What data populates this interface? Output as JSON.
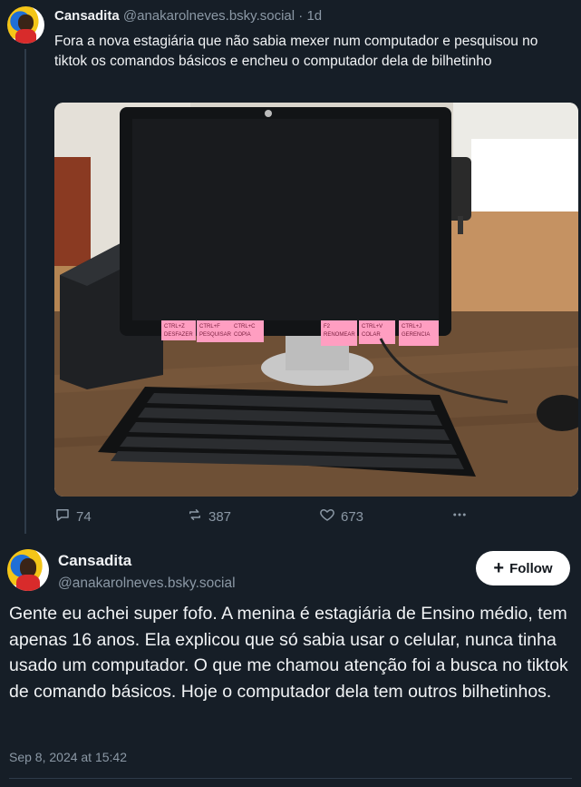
{
  "post1": {
    "author_name": "Cansadita",
    "handle": "@anakarolneves.bsky.social",
    "separator": " · ",
    "time_ago": "1d",
    "text": "Fora a nova estagiária que não sabia mexer num computador e pesquisou no tiktok os comandos básicos e encheu o computador dela de bilhetinho",
    "image": {
      "sticky_notes": [
        "CTRL+Z DESFAZER",
        "CTRL+F PESQUISAR PALAVRA",
        "CTRL+C COPIA",
        "F2 RENOMEAR UM ARQUIVO",
        "CTRL+V COLAR",
        "CTRL+J GERENCIA OS DOWNLOADS"
      ]
    },
    "actions": {
      "replies": "74",
      "reposts": "387",
      "likes": "673"
    }
  },
  "post2": {
    "author_name": "Cansadita",
    "handle": "@anakarolneves.bsky.social",
    "follow_label": "Follow",
    "text": "Gente eu achei super fofo. A menina é estagiária de Ensino médio, tem apenas 16 anos. Ela explicou que só sabia usar o celular, nunca tinha usado um computador. O que me chamou atenção foi a busca no tiktok de comando básicos. Hoje o computador dela tem outros bilhetinhos.",
    "timestamp": "Sep 8, 2024 at 15:42"
  },
  "icons": {
    "reply": "speech-bubble-icon",
    "repost": "repost-arrows-icon",
    "like": "heart-icon",
    "more": "ellipsis-icon",
    "follow": "plus-icon"
  },
  "colors": {
    "background": "#161e27",
    "muted_text": "#8b98a5",
    "follow_button": "#ffffff"
  }
}
